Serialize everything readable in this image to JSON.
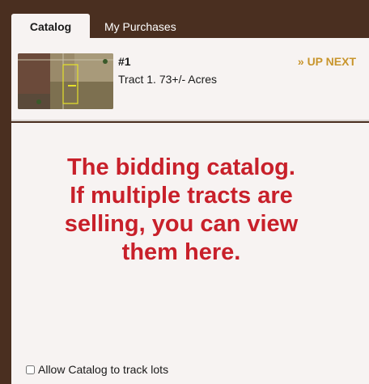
{
  "tabs": [
    {
      "label": "Catalog",
      "active": true
    },
    {
      "label": "My Purchases",
      "active": false
    }
  ],
  "lot": {
    "number": "#1",
    "status": "» UP NEXT",
    "title": "Tract 1. 73+/- Acres",
    "thumbnail_icon": "aerial-map-icon"
  },
  "annotation": {
    "text_lines": [
      "The bidding catalog.",
      "If multiple tracts are",
      "selling, you can view",
      "them here."
    ]
  },
  "track_lots": {
    "label": "Allow Catalog to track lots",
    "checked": false
  },
  "colors": {
    "frame": "#4a2f20",
    "panel": "#f7f3f2",
    "accent_gold": "#c8952c",
    "annotation_red": "#c8202a"
  }
}
